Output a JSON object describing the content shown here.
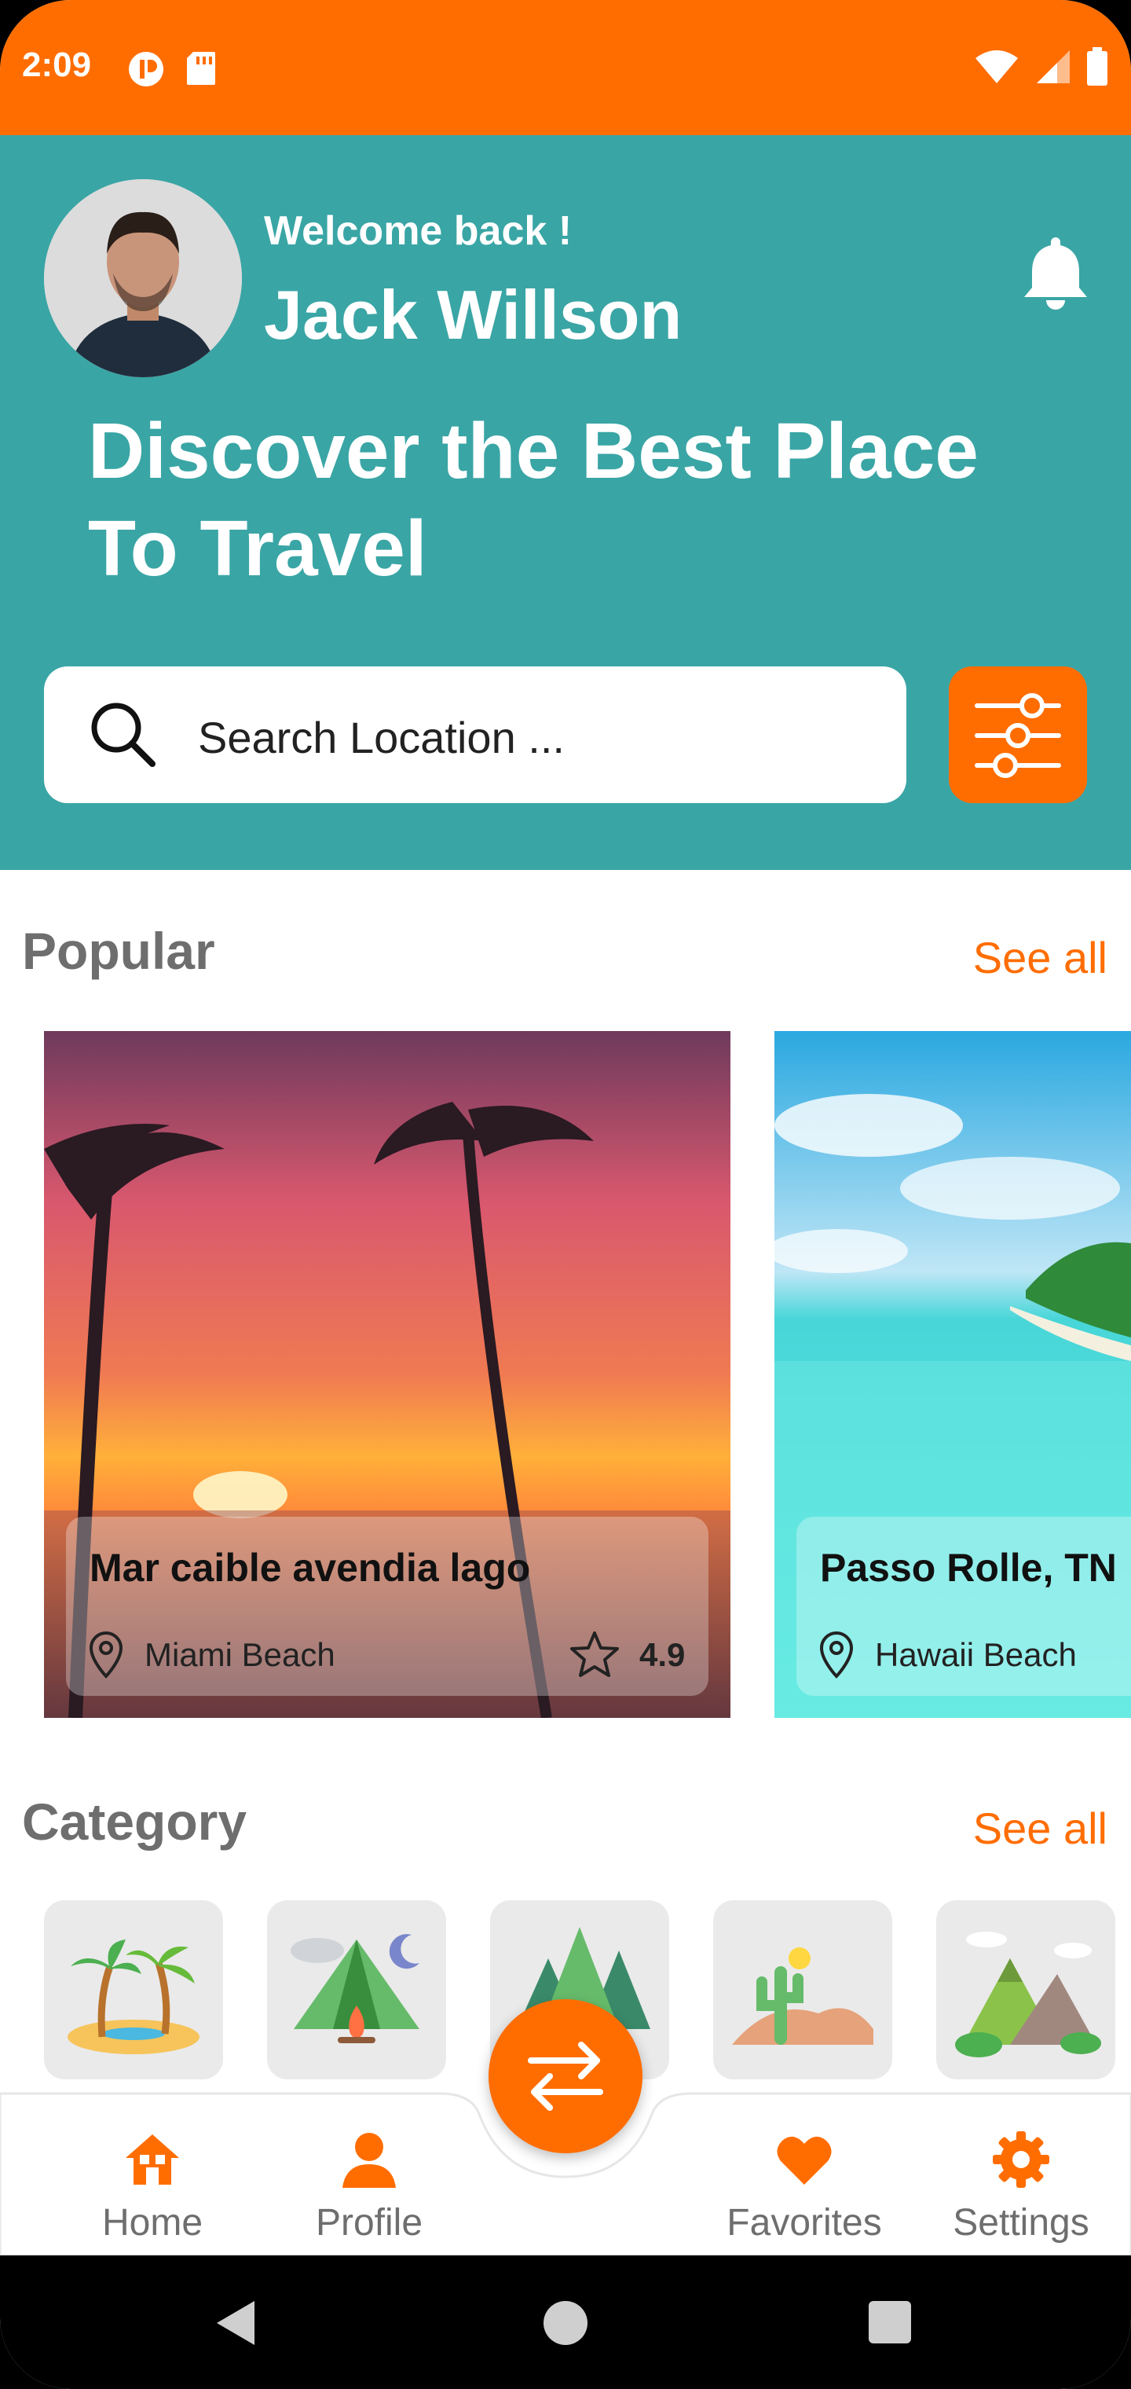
{
  "status_bar": {
    "time": "2:09"
  },
  "header": {
    "welcome": "Welcome back !",
    "user_name": "Jack Willson",
    "headline_line1": "Discover the Best Place",
    "headline_line2": "To Travel",
    "search_placeholder": "Search Location ..."
  },
  "popular": {
    "title": "Popular",
    "see_all": "See all",
    "cards": [
      {
        "title": "Mar caible avendia lago",
        "location": "Miami Beach",
        "rating": "4.9"
      },
      {
        "title": "Passo Rolle, TN",
        "location": "Hawaii Beach"
      }
    ]
  },
  "category": {
    "title": "Category",
    "see_all": "See all",
    "items": [
      "beach-palms",
      "camping-tent",
      "forest-trees",
      "desert-cactus",
      "mountains"
    ]
  },
  "bottom_nav": {
    "items": [
      {
        "label": "Home",
        "icon": "home-icon"
      },
      {
        "label": "Profile",
        "icon": "person-icon"
      },
      {
        "label": "Favorites",
        "icon": "heart-icon"
      },
      {
        "label": "Settings",
        "icon": "gear-icon"
      }
    ]
  },
  "colors": {
    "accent": "#FF6D00",
    "header": "#3AA5A5"
  }
}
